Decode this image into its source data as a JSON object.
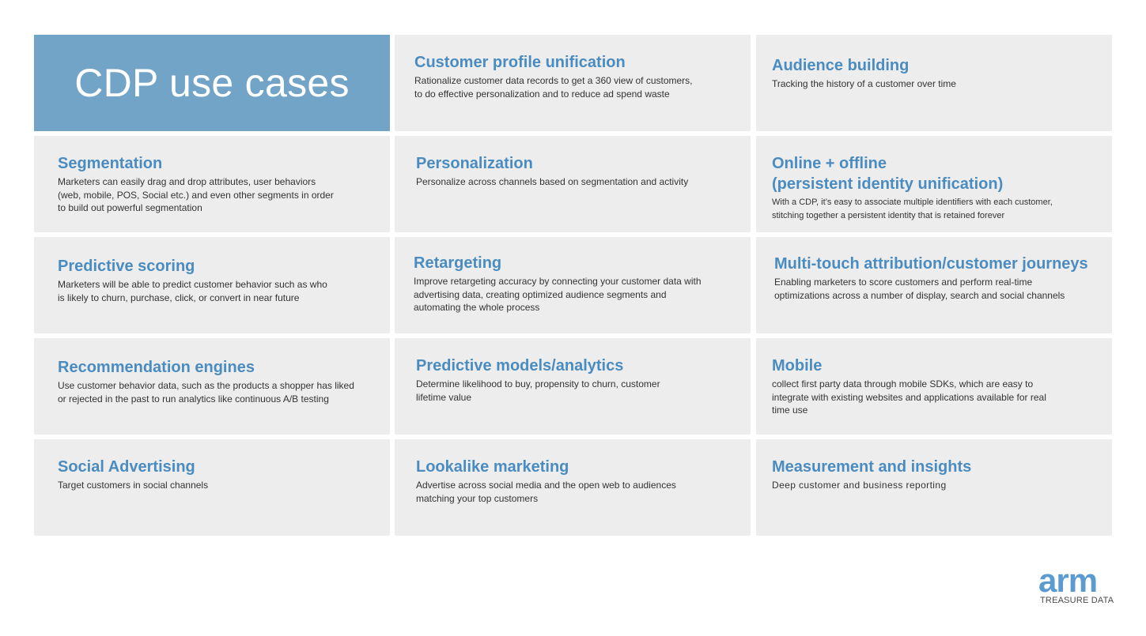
{
  "title": "CDP use cases",
  "colors": {
    "title_bg": "#72a4c8",
    "heading": "#4a8cc0",
    "cell_bg": "#ededed",
    "logo": "#5b9bd0"
  },
  "cards": [
    {
      "heading": "Customer profile unification",
      "body": "Rationalize customer data records to get a 360 view of customers,\nto do effective personalization and to reduce ad spend waste"
    },
    {
      "heading": "Audience building",
      "body": "Tracking the history of a customer over time"
    },
    {
      "heading": "Segmentation",
      "body": "Marketers can easily drag and drop attributes, user behaviors\n(web, mobile, POS, Social etc.) and even other segments in order\nto build out powerful segmentation"
    },
    {
      "heading": "Personalization",
      "body": "Personalize across channels based on segmentation and activity"
    },
    {
      "heading": "Online + offline\n(persistent identity unification)",
      "body": "With a CDP, it’s easy to associate multiple identifiers with each customer,\nstitching together a persistent identity that is retained forever"
    },
    {
      "heading": "Predictive scoring",
      "body": "Marketers will be able to predict customer behavior such as who\nis likely to churn, purchase, click, or convert in near future"
    },
    {
      "heading": "Retargeting",
      "body": "Improve retargeting accuracy by connecting your customer data with\nadvertising data, creating optimized audience segments and\nautomating the whole process"
    },
    {
      "heading": "Multi-touch attribution/customer journeys",
      "body": "Enabling marketers to score customers and perform real-time\noptimizations across a number of display, search and social channels"
    },
    {
      "heading": "Recommendation engines",
      "body": "Use customer behavior data, such as the products a shopper has liked\nor rejected in the past to run analytics like continuous A/B testing"
    },
    {
      "heading": "Predictive models/analytics",
      "body": "Determine likelihood to buy, propensity to churn, customer\nlifetime value"
    },
    {
      "heading": "Mobile",
      "body": "collect first party data through mobile SDKs, which are easy to\nintegrate with existing websites and applications available for real\ntime use"
    },
    {
      "heading": "Social Advertising",
      "body": "Target customers in social channels"
    },
    {
      "heading": "Lookalike marketing",
      "body": "Advertise across social media and the open web to audiences\nmatching your top customers"
    },
    {
      "heading": "Measurement and insights",
      "body": "Deep customer and business reporting"
    }
  ],
  "logo": {
    "wordmark": "arm",
    "subtitle": "TREASURE DATA"
  }
}
